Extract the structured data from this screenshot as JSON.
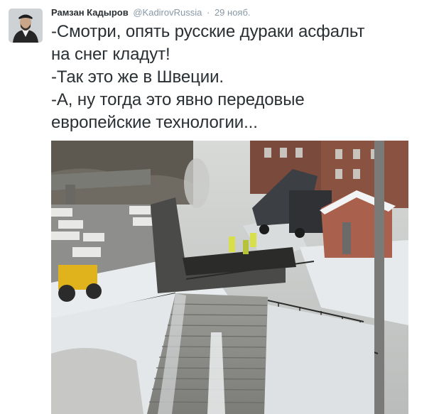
{
  "tweet": {
    "author_name": "Рамзан Кадыров",
    "handle": "@KadirovRussia",
    "separator": "·",
    "date": "29 нояб.",
    "lines": [
      "-Смотри, опять русские дураки асфальт",
      "на снег кладут!",
      "-Так это же в Швеции.",
      "-А, ну тогда это явно передовые",
      "европейские технологии..."
    ]
  },
  "colors": {
    "name": "#292f33",
    "meta": "#8899a6",
    "text": "#292f33"
  }
}
